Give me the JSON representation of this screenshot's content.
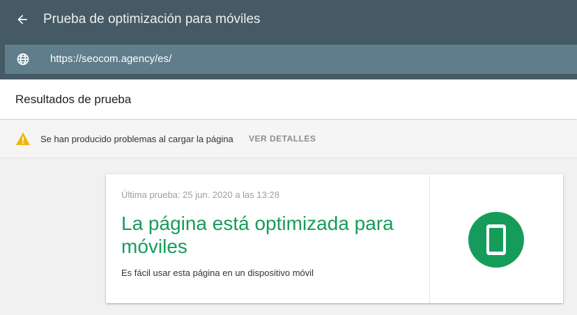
{
  "header": {
    "title": "Prueba de optimización para móviles",
    "back_icon": "arrow-left-icon",
    "url_icon": "globe-icon",
    "url": "https://seocom.agency/es/"
  },
  "results": {
    "title": "Resultados de prueba"
  },
  "warning": {
    "icon": "warning-triangle-icon",
    "text": "Se han producido problemas al cargar la página",
    "link_label": "VER DETALLES"
  },
  "result_card": {
    "last_test": "Última prueba: 25 jun. 2020 a las 13:28",
    "title": "La página está optimizada para móviles",
    "description": "Es fácil usar esta página en un dispositivo móvil",
    "badge_icon": "mobile-phone-icon"
  },
  "colors": {
    "header_bg": "#455a64",
    "url_bar_bg": "#607d8b",
    "success_green": "#169c5a",
    "warning_yellow": "#f5b400"
  }
}
